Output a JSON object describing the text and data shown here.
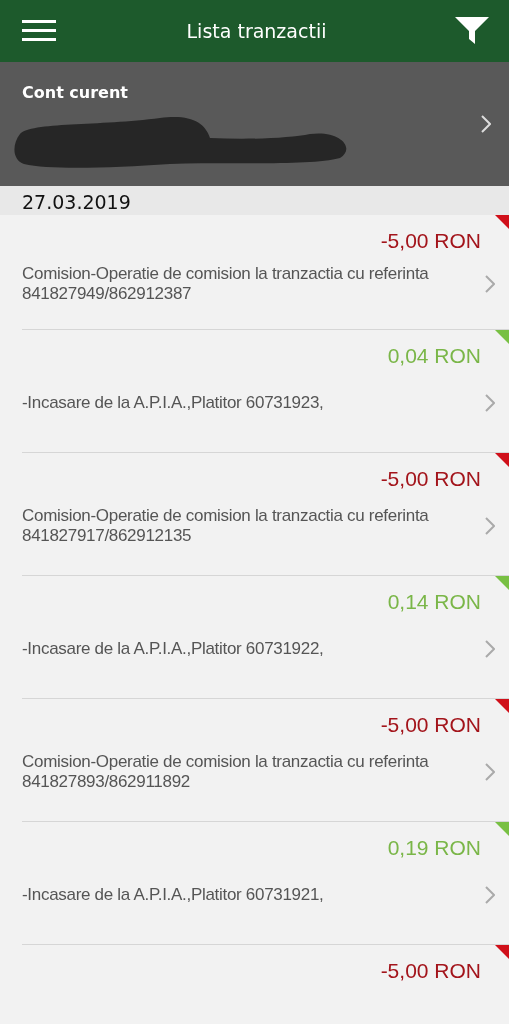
{
  "header": {
    "title": "Lista tranzactii"
  },
  "account": {
    "label": "Cont curent"
  },
  "date": "27.03.2019",
  "transactions": [
    {
      "kind": "debit",
      "amount": "-5,00 RON",
      "description": "Comision-Operatie de comision la tranzactia cu referinta 841827949/862912387"
    },
    {
      "kind": "credit",
      "amount": "0,04 RON",
      "description": "-Incasare de la A.P.I.A.,Platitor 60731923,"
    },
    {
      "kind": "debit",
      "amount": "-5,00 RON",
      "description": "Comision-Operatie de comision la tranzactia cu referinta 841827917/862912135"
    },
    {
      "kind": "credit",
      "amount": "0,14 RON",
      "description": "-Incasare de la A.P.I.A.,Platitor 60731922,"
    },
    {
      "kind": "debit",
      "amount": "-5,00 RON",
      "description": "Comision-Operatie de comision la tranzactia cu referinta 841827893/862911892"
    },
    {
      "kind": "credit",
      "amount": "0,19 RON",
      "description": "-Incasare de la A.P.I.A.,Platitor 60731921,"
    },
    {
      "kind": "debit",
      "amount": "-5,00 RON"
    }
  ]
}
